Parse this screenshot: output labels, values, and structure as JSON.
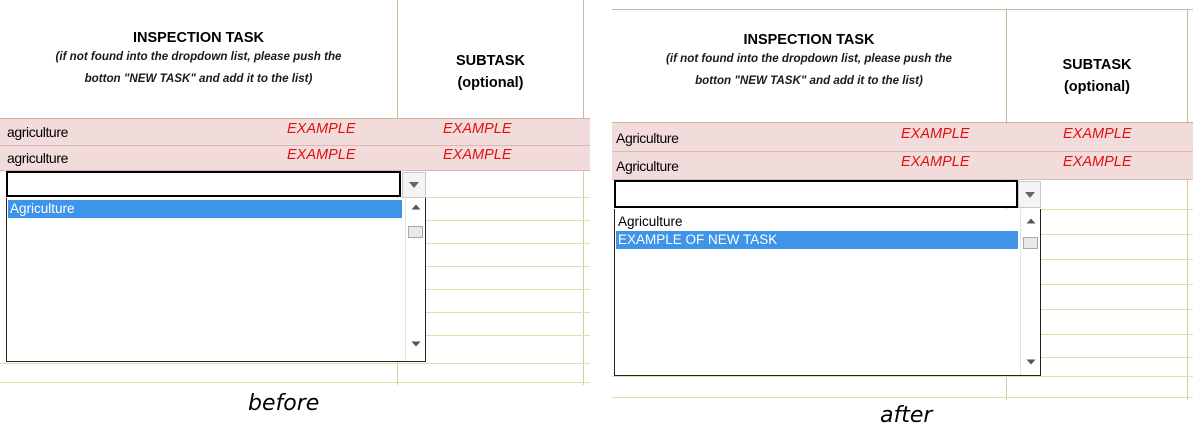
{
  "before": {
    "header": {
      "task_title": "INSPECTION TASK",
      "task_note_line1": "(if not found into the dropdown list, please push the",
      "task_note_line2": "botton \"NEW TASK\" and add it to the list)",
      "subtask_line1": "SUBTASK",
      "subtask_line2": "(optional)"
    },
    "rows": [
      {
        "task": "agriculture",
        "example_task": "EXAMPLE",
        "example_subtask": "EXAMPLE"
      },
      {
        "task": "agriculture",
        "example_task": "EXAMPLE",
        "example_subtask": "EXAMPLE"
      }
    ],
    "dropdown": {
      "input_value": "",
      "options": [
        "Agriculture"
      ],
      "selected_option": "Agriculture"
    },
    "caption": "before"
  },
  "after": {
    "header": {
      "task_title": "INSPECTION TASK",
      "task_note_line1": "(if not found into the dropdown list, please push the",
      "task_note_line2": "botton \"NEW TASK\" and add it to the list)",
      "subtask_line1": "SUBTASK",
      "subtask_line2": "(optional)"
    },
    "rows": [
      {
        "task": "Agriculture",
        "example_task": "EXAMPLE",
        "example_subtask": "EXAMPLE"
      },
      {
        "task": "Agriculture",
        "example_task": "EXAMPLE",
        "example_subtask": "EXAMPLE"
      }
    ],
    "dropdown": {
      "input_value": "",
      "options": [
        "Agriculture",
        "EXAMPLE OF NEW TASK"
      ],
      "selected_option": "EXAMPLE OF NEW TASK"
    },
    "caption": "after"
  },
  "colors": {
    "row_fill": "#f2dcdb",
    "example_text": "#e01010",
    "selection": "#3d94e9",
    "grid": "#e6dcb0"
  }
}
